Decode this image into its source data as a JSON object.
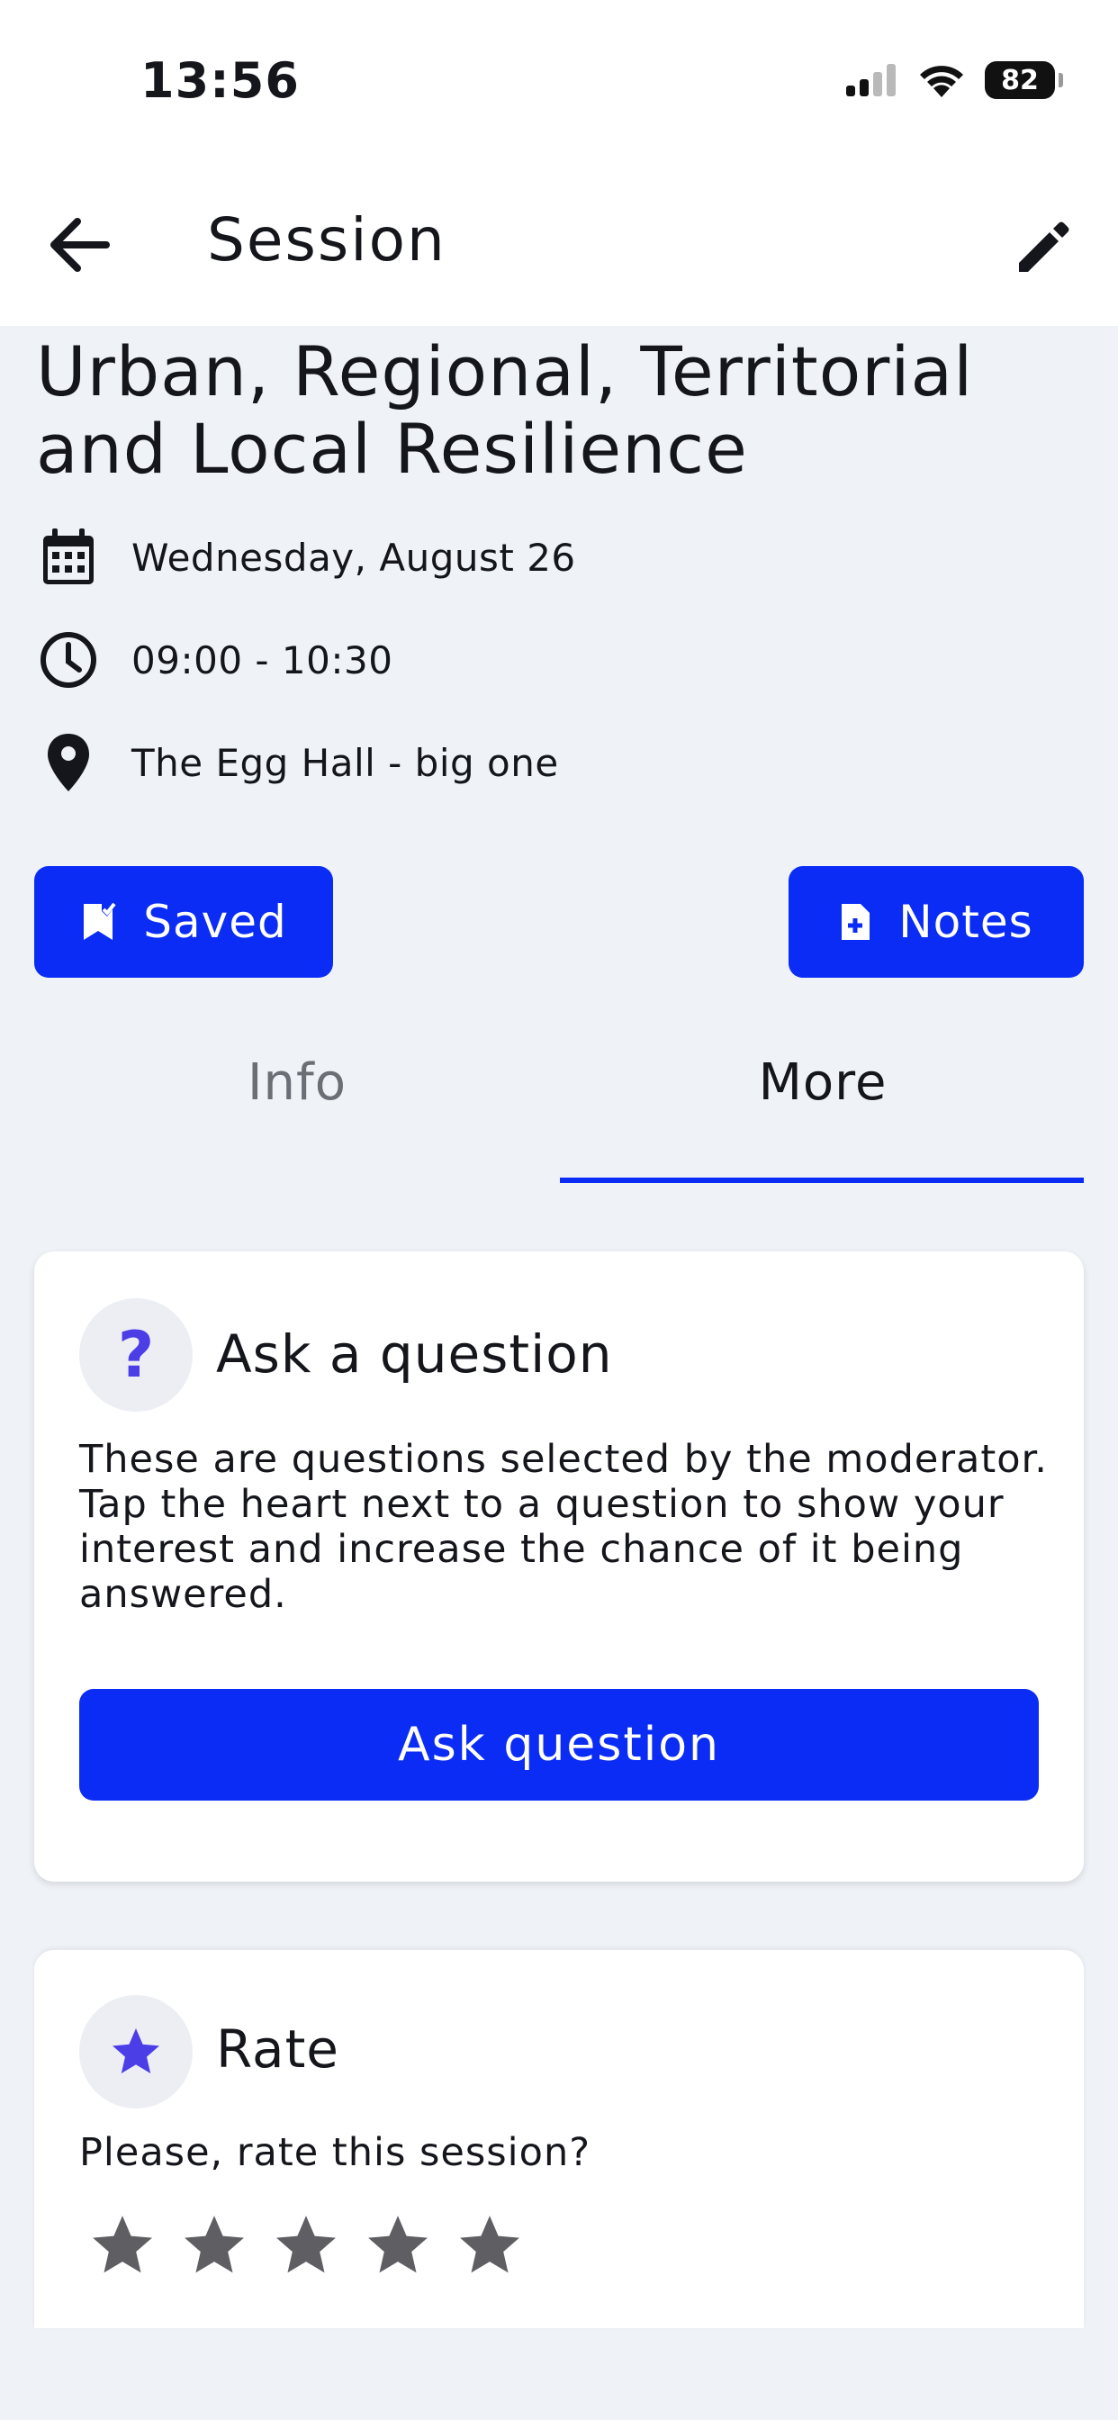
{
  "status_bar": {
    "time": "13:56",
    "battery": "82"
  },
  "app_bar": {
    "title": "Session"
  },
  "session": {
    "title": "Urban, Regional, Territorial and Local Resilience",
    "date": "Wednesday, August 26",
    "time": "09:00 - 10:30",
    "location": "The Egg Hall - big one"
  },
  "actions": {
    "saved_label": "Saved",
    "notes_label": "Notes"
  },
  "tabs": [
    {
      "label": "Info",
      "active": false
    },
    {
      "label": "More",
      "active": true
    }
  ],
  "ask_card": {
    "title": "Ask a question",
    "icon_glyph": "?",
    "description": "These are questions selected by the moderator. Tap the heart next to a question to show your interest and increase the chance of it being answered.",
    "button_label": "Ask question"
  },
  "rate_card": {
    "title": "Rate",
    "prompt": "Please, rate this session?",
    "rating": 0,
    "max_rating": 5
  },
  "colors": {
    "accent": "#0b2cf5",
    "icon_purple": "#4b3ee6",
    "star_inactive": "#5f5f63"
  }
}
